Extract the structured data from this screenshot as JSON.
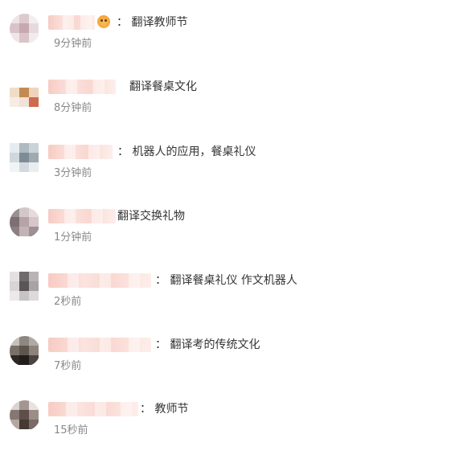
{
  "comments": [
    {
      "content": "： 翻译教师节",
      "time": "9分钟前"
    },
    {
      "content": "翻译餐桌文化",
      "time": "8分钟前"
    },
    {
      "content": "： 机器人的应用，餐桌礼仪",
      "time": "3分钟前"
    },
    {
      "content": "翻译交换礼物",
      "time": "1分钟前"
    },
    {
      "content": "： 翻译餐桌礼仪 作文机器人",
      "time": "2秒前"
    },
    {
      "content": "： 翻译考的传统文化",
      "time": "7秒前"
    },
    {
      "content": "： 教师节",
      "time": "15秒前"
    }
  ],
  "icons": {
    "emoji": "smiley-emoji-icon"
  }
}
